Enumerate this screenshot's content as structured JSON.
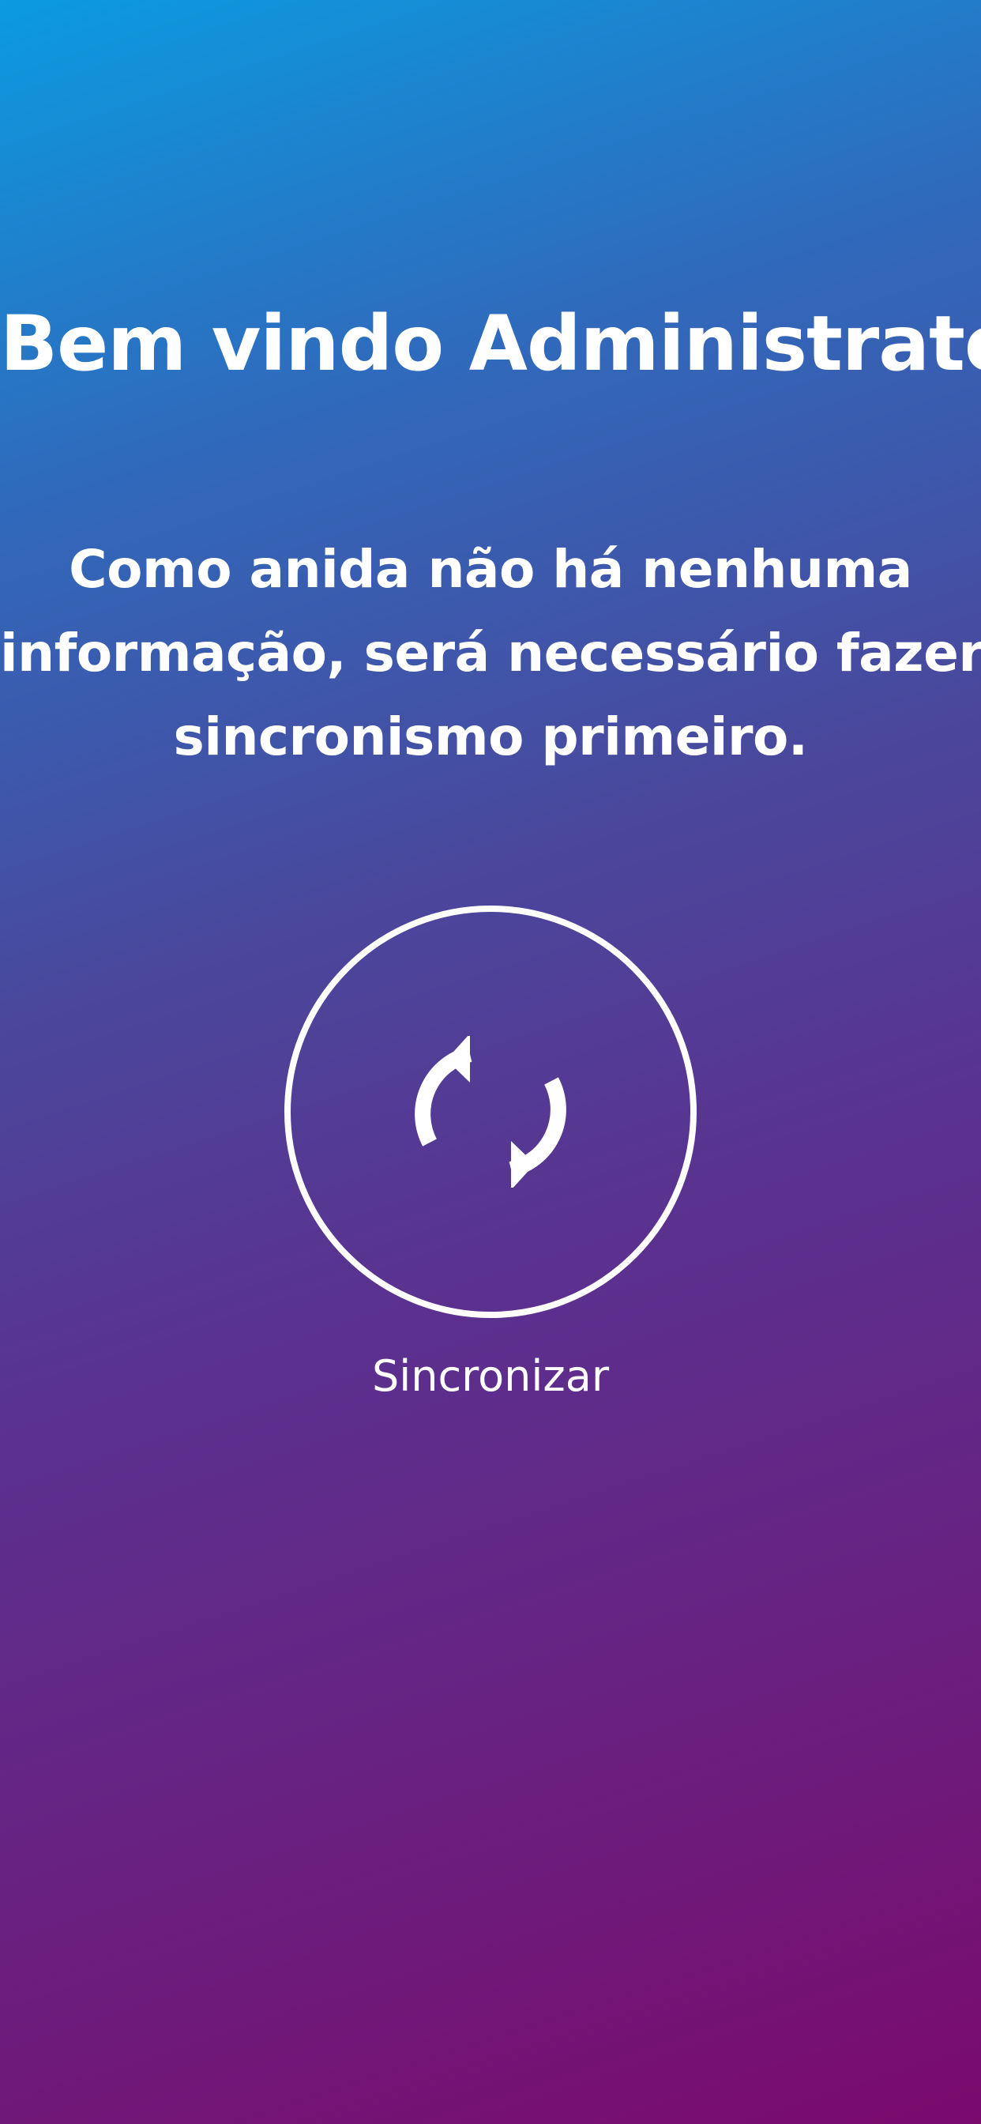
{
  "welcome": {
    "title": "Bem vindo Administrator"
  },
  "message": {
    "lines": [
      "Como anida não há nenhuma",
      "informação, será necessário fazer o",
      "sincronismo primeiro."
    ]
  },
  "sync": {
    "icon": "sync-icon",
    "label": "Sincronizar"
  },
  "colors": {
    "gradient_top": "#0b9be0",
    "gradient_bottom": "#7b0a6d",
    "text": "#ffffff"
  }
}
